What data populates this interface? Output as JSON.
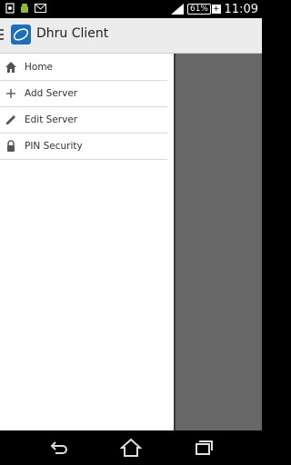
{
  "status_bar": {
    "time": "11:09",
    "battery_percent": "61%",
    "battery_plus": "+"
  },
  "action_bar": {
    "title": "Dhru Client"
  },
  "drawer": {
    "items": [
      {
        "label": "Home",
        "icon": "home-icon"
      },
      {
        "label": "Add Server",
        "icon": "plus-icon"
      },
      {
        "label": "Edit Server",
        "icon": "pencil-icon"
      },
      {
        "label": "PIN Security",
        "icon": "lock-icon"
      }
    ]
  },
  "nav_bar": {
    "buttons": [
      "back-icon",
      "home-icon",
      "recent-apps-icon"
    ]
  }
}
